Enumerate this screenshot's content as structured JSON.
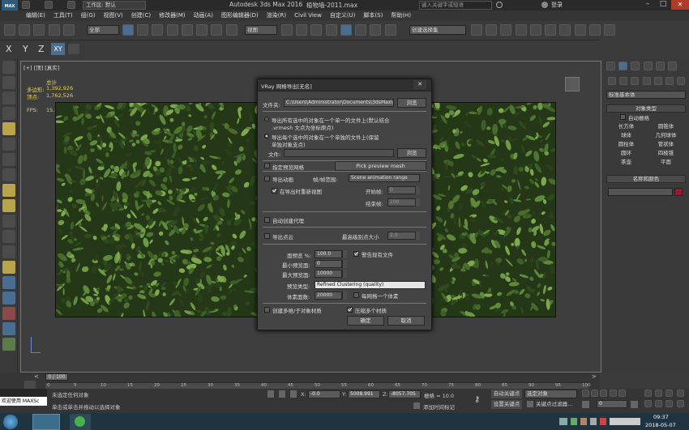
{
  "titlebar": {
    "max_label": "MAX",
    "workspace_label": "工作区: 默认",
    "app_title": "Autodesk 3ds Max 2016",
    "file_name": "植物墙-2011.max",
    "search_placeholder": "键入关键字或短语",
    "login_label": "登录"
  },
  "menu": [
    "编辑(E)",
    "工具(T)",
    "组(G)",
    "视图(V)",
    "创建(C)",
    "修改器(M)",
    "动画(A)",
    "图形编辑器(D)",
    "渲染(R)",
    "Civil View",
    "自定义(U)",
    "脚本(S)",
    "帮助(H)"
  ],
  "toolbar": {
    "selection_filter": "全部",
    "reference_coord": "视图",
    "named_selection": "创建选择集"
  },
  "axis": {
    "x": "X",
    "y": "Y",
    "z": "Z",
    "xy": "XY"
  },
  "viewport": {
    "label": "[+] [顶] [真实]",
    "stats_total_label": "总计",
    "polys_label": "多边形:",
    "polys_value": "1,392,926",
    "verts_label": "顶点:",
    "verts_value": "1,762,526",
    "fps_label": "FPS:",
    "fps_value": "15.6"
  },
  "dialog": {
    "title": "VRay 网格导出[无名]",
    "folder_label": "文件夹:",
    "folder_value": "C:\\Users\\Administrator\\Documents\\3dsMax\\export",
    "browse1": "浏览",
    "radio1": "导出所有选中的对象在一个单一的文件上(默认结合.vrmesh 文点为坐标原点)",
    "radio1_line1": "导出所有选中的对象在一个单一的文件上(默认结合",
    "radio1_line2": ".vrmesh 文点为坐标原点)",
    "radio2_line1": "导出每个选中的对象在一个单独的文件上(保留",
    "radio2_line2": "单独对象支点)",
    "file_label": "文件:",
    "browse2": "浏览",
    "auto_preview": "指定预览网格",
    "pick_preview": "Pick preview mesh",
    "export_anim": "导出动画",
    "frame_range_label": "帧/帧范围:",
    "frame_range_value": "Scene animation range",
    "use_in_viewport": "在导出时重新视图",
    "start_label": "开始帧:",
    "start_value": "0",
    "end_label": "结束帧:",
    "end_value": "100",
    "auto_proxy": "自动创建代理",
    "export_points": "导出点云",
    "point_size_label": "最高级别点大小",
    "point_size_value": "2.0",
    "faces_label": "面预览 %:",
    "faces_value": "100.0",
    "min_faces_label": "最小预览面:",
    "min_faces_value": "0",
    "max_faces_label": "最大预览面:",
    "max_faces_value": "10000",
    "warn_label": "警告现有文件",
    "preview_type_label": "预览类型:",
    "preview_type_value": "Refined Clustering (quality)",
    "voxel_label": "体素面数:",
    "voxel_value": "20000",
    "one_voxel_label": "每网格一个体素",
    "create_multi_label": "创建多维/子对象材质",
    "compress_label": "压缩多个材质",
    "ok": "确定",
    "cancel": "取消"
  },
  "cmdpanel": {
    "dropdown": "标准基本体",
    "object_type_header": "对象类型",
    "autogrid": "自动栅格",
    "buttons": [
      "长方体",
      "圆锥体",
      "球体",
      "几何球体",
      "圆柱体",
      "管状体",
      "圆环",
      "四棱锥",
      "茶壶",
      "平面"
    ],
    "name_color_header": "名称和颜色",
    "color_swatch": "#9b1830"
  },
  "timeline": {
    "frame_counter": "0 / 100",
    "ticks": [
      "0",
      "5",
      "10",
      "15",
      "20",
      "25",
      "30",
      "35",
      "40",
      "45",
      "50",
      "55",
      "60",
      "65",
      "70",
      "75",
      "80",
      "85",
      "90",
      "95",
      "100"
    ]
  },
  "status": {
    "welcome": "欢迎使用 MAXSc",
    "line1": "未选定任何对象",
    "line2": "单击或单击并拖动以选择对象",
    "x_label": "X:",
    "x_value": "-0.0",
    "y_label": "Y:",
    "y_value": "5008.991",
    "z_label": "Z:",
    "z_value": "-8057.705",
    "grid_label": "栅格 = 10.0",
    "add_time_tag": "添加时间标记",
    "auto_key": "自动关键点",
    "set_key": "设置关键点",
    "selected_obj": "选定对象",
    "key_filters": "关键点过滤器...",
    "frame_value": "0"
  },
  "taskbar": {
    "time": "09:37",
    "date": "2018-05-07"
  },
  "colors": {
    "accent_blue": "#4a6e92",
    "plant_dark": "#243818"
  }
}
